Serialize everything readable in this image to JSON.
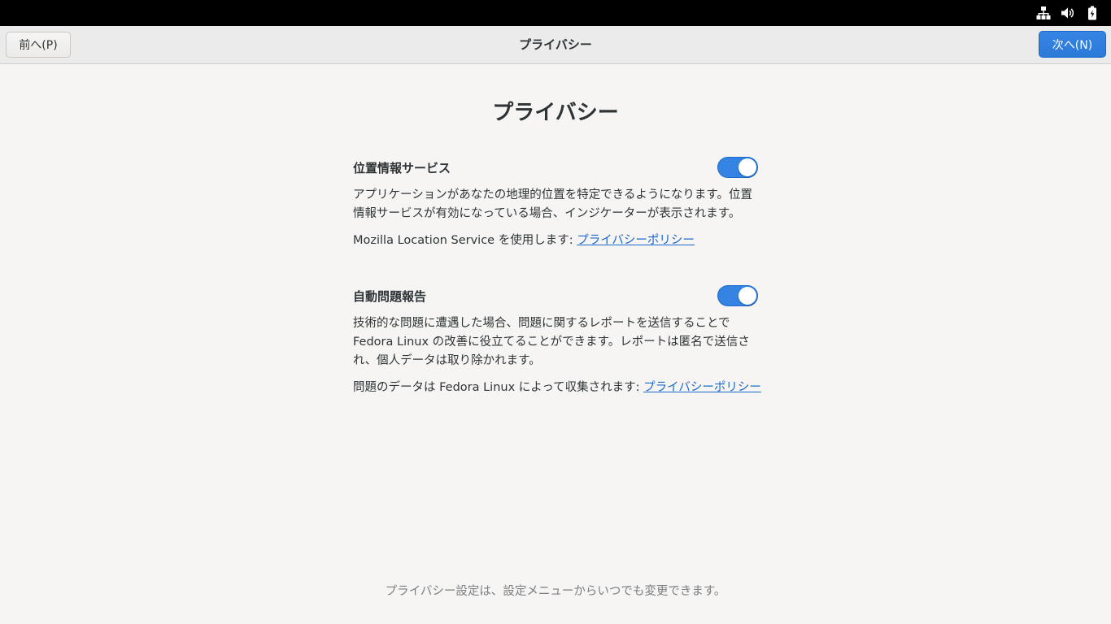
{
  "topbar": {
    "icons": [
      "network-wired-icon",
      "volume-icon",
      "battery-icon"
    ]
  },
  "header": {
    "prev_label": "前へ(P)",
    "title": "プライバシー",
    "next_label": "次へ(N)"
  },
  "page": {
    "title": "プライバシー"
  },
  "location": {
    "title": "位置情報サービス",
    "enabled": true,
    "description": "アプリケーションがあなたの地理的位置を特定できるようになります。位置情報サービスが有効になっている場合、インジケーターが表示されます。",
    "credit_prefix": "Mozilla Location Service を使用します: ",
    "policy_link": "プライバシーポリシー"
  },
  "reporting": {
    "title": "自動問題報告",
    "enabled": true,
    "description": "技術的な問題に遭遇した場合、問題に関するレポートを送信することでFedora Linux の改善に役立てることができます。レポートは匿名で送信され、個人データは取り除かれます。",
    "credit_prefix": "問題のデータは Fedora Linux によって収集されます: ",
    "policy_link": "プライバシーポリシー"
  },
  "footer": {
    "note": "プライバシー設定は、設定メニューからいつでも変更できます。"
  },
  "colors": {
    "accent": "#3584e4",
    "link": "#1b6acb",
    "background": "#f6f5f4",
    "topbar": "#000000"
  }
}
